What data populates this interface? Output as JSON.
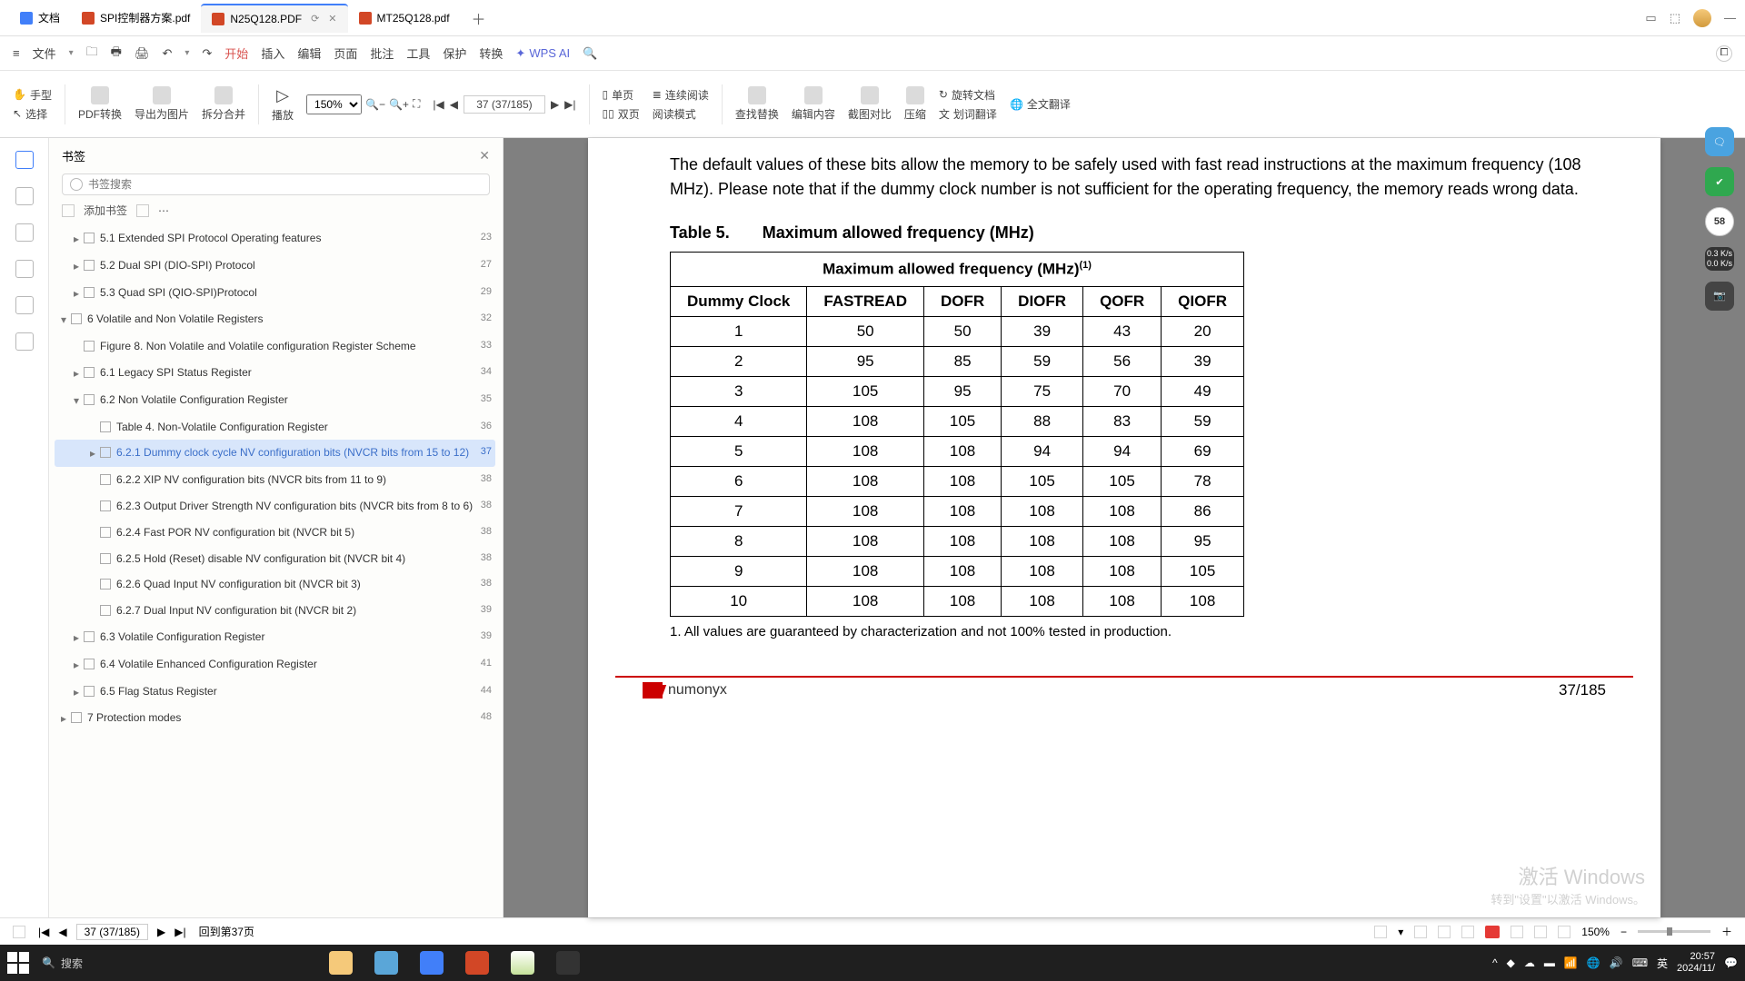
{
  "tabs": {
    "docs_label": "文档",
    "t1": "SPI控制器方案.pdf",
    "t2": "N25Q128.PDF",
    "t3": "MT25Q128.pdf"
  },
  "menu": {
    "file": "文件",
    "start": "开始",
    "insert": "插入",
    "edit": "编辑",
    "page": "页面",
    "approve": "批注",
    "tool": "工具",
    "protect": "保护",
    "convert": "转换",
    "wpsai": "WPS AI"
  },
  "ribbon": {
    "hand": "手型",
    "select": "选择",
    "pdfconv": "PDF转换",
    "exportimg": "导出为图片",
    "splitmerge": "拆分合并",
    "play": "播放",
    "zoom": "150%",
    "pagebox": "37 (37/185)",
    "singlepage": "单页",
    "doublepage": "双页",
    "contread": "连续阅读",
    "readmode": "阅读模式",
    "findreplace": "查找替换",
    "editcontent": "编辑内容",
    "cutcompare": "截图对比",
    "compress": "压缩",
    "rotate": "旋转文档",
    "fulltrans": "全文翻译",
    "highlight": "划词翻译"
  },
  "bookmarks": {
    "title": "书签",
    "search_placeholder": "书签搜索",
    "addbm": "添加书签",
    "items": [
      {
        "exp": "▸",
        "label": "5.1 Extended SPI Protocol Operating features",
        "pg": "23",
        "ind": 1
      },
      {
        "exp": "▸",
        "label": "5.2 Dual SPI (DIO-SPI) Protocol",
        "pg": "27",
        "ind": 1
      },
      {
        "exp": "▸",
        "label": "5.3 Quad SPI (QIO-SPI)Protocol",
        "pg": "29",
        "ind": 1
      },
      {
        "exp": "▾",
        "label": "6 Volatile and Non Volatile Registers",
        "pg": "32",
        "ind": 0
      },
      {
        "exp": "",
        "label": "Figure 8. Non Volatile and Volatile configuration Register Scheme",
        "pg": "33",
        "ind": 1
      },
      {
        "exp": "▸",
        "label": "6.1 Legacy SPI Status Register",
        "pg": "34",
        "ind": 1
      },
      {
        "exp": "▾",
        "label": "6.2 Non Volatile Configuration Register",
        "pg": "35",
        "ind": 1
      },
      {
        "exp": "",
        "label": "Table 4. Non-Volatile Configuration Register",
        "pg": "36",
        "ind": 2
      },
      {
        "exp": "▸",
        "label": "6.2.1 Dummy clock cycle NV configuration bits (NVCR bits from 15 to 12)",
        "pg": "37",
        "ind": 2,
        "sel": true
      },
      {
        "exp": "",
        "label": "6.2.2 XIP NV configuration bits (NVCR bits from 11 to 9)",
        "pg": "38",
        "ind": 2
      },
      {
        "exp": "",
        "label": "6.2.3 Output Driver Strength NV configuration bits (NVCR bits from 8 to 6)",
        "pg": "38",
        "ind": 2
      },
      {
        "exp": "",
        "label": "6.2.4 Fast POR NV configuration bit (NVCR bit 5)",
        "pg": "38",
        "ind": 2
      },
      {
        "exp": "",
        "label": "6.2.5 Hold (Reset) disable NV configuration bit (NVCR bit 4)",
        "pg": "38",
        "ind": 2
      },
      {
        "exp": "",
        "label": "6.2.6 Quad Input NV configuration bit (NVCR bit 3)",
        "pg": "38",
        "ind": 2
      },
      {
        "exp": "",
        "label": "6.2.7 Dual Input NV configuration bit (NVCR bit 2)",
        "pg": "39",
        "ind": 2
      },
      {
        "exp": "▸",
        "label": "6.3 Volatile Configuration Register",
        "pg": "39",
        "ind": 1
      },
      {
        "exp": "▸",
        "label": "6.4 Volatile Enhanced Configuration Register",
        "pg": "41",
        "ind": 1
      },
      {
        "exp": "▸",
        "label": "6.5 Flag Status Register",
        "pg": "44",
        "ind": 1
      },
      {
        "exp": "▸",
        "label": "7 Protection modes",
        "pg": "48",
        "ind": 0
      }
    ]
  },
  "doc": {
    "intro": "The default values of these bits allow the memory to be safely used with fast read instructions at the maximum frequency (108 MHz). Please note that if the dummy clock number is not sufficient for the operating frequency, the memory reads wrong data.",
    "caption_num": "Table 5.",
    "caption_txt": "Maximum allowed frequency (MHz)",
    "spanhead": "Maximum allowed frequency (MHz)",
    "footnote": "1.    All values are guaranteed by characterization and not 100% tested in production.",
    "brand": "numonyx",
    "pgnum": "37/185"
  },
  "chart_data": {
    "type": "table",
    "title": "Maximum allowed frequency (MHz)",
    "columns": [
      "Dummy Clock",
      "FASTREAD",
      "DOFR",
      "DIOFR",
      "QOFR",
      "QIOFR"
    ],
    "rows": [
      [
        "1",
        "50",
        "50",
        "39",
        "43",
        "20"
      ],
      [
        "2",
        "95",
        "85",
        "59",
        "56",
        "39"
      ],
      [
        "3",
        "105",
        "95",
        "75",
        "70",
        "49"
      ],
      [
        "4",
        "108",
        "105",
        "88",
        "83",
        "59"
      ],
      [
        "5",
        "108",
        "108",
        "94",
        "94",
        "69"
      ],
      [
        "6",
        "108",
        "108",
        "105",
        "105",
        "78"
      ],
      [
        "7",
        "108",
        "108",
        "108",
        "108",
        "86"
      ],
      [
        "8",
        "108",
        "108",
        "108",
        "108",
        "95"
      ],
      [
        "9",
        "108",
        "108",
        "108",
        "108",
        "105"
      ],
      [
        "10",
        "108",
        "108",
        "108",
        "108",
        "108"
      ]
    ]
  },
  "rightfloat": {
    "score": "58",
    "rate1": "0.3\nK/s",
    "rate2": "0.0\nK/s"
  },
  "watermark": {
    "l1": "激活 Windows",
    "l2": "转到\"设置\"以激活 Windows。"
  },
  "status": {
    "pagebox": "37 (37/185)",
    "backto": "回到第37页",
    "zoom": "150%"
  },
  "taskbar": {
    "search": "搜索",
    "time": "20:57",
    "date": "2024/11/",
    "ime1": "▲",
    "lang": "英"
  }
}
